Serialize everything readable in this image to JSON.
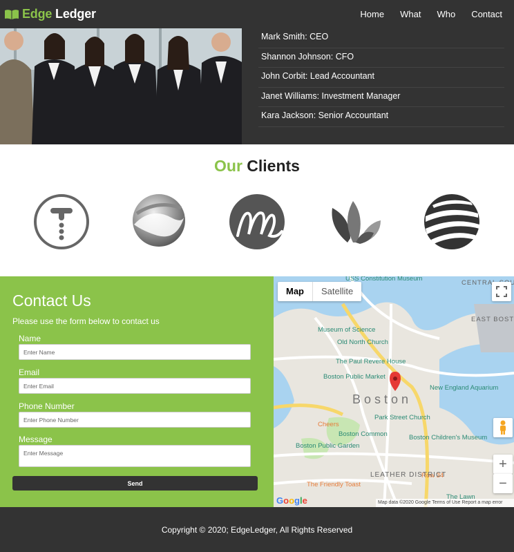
{
  "brand": {
    "accent": "Edge",
    "rest": "Ledger",
    "accent_color": "#8bc34a"
  },
  "nav": [
    {
      "label": "Home"
    },
    {
      "label": "What"
    },
    {
      "label": "Who"
    },
    {
      "label": "Contact"
    }
  ],
  "team": [
    {
      "text": "Mark Smith: CEO"
    },
    {
      "text": "Shannon Johnson: CFO"
    },
    {
      "text": "John Corbit: Lead Accountant"
    },
    {
      "text": "Janet Williams: Investment Manager"
    },
    {
      "text": "Kara Jackson: Senior Accountant"
    }
  ],
  "clients": {
    "title_accent": "Our",
    "title_rest": "Clients",
    "logos": [
      "t-circle-logo",
      "swirl-sphere-logo",
      "m-script-logo",
      "leaves-logo",
      "striped-globe-logo"
    ]
  },
  "contact": {
    "title": "Contact Us",
    "subtitle": "Please use the form below to contact us",
    "fields": [
      {
        "label": "Name",
        "placeholder": "Enter Name"
      },
      {
        "label": "Email",
        "placeholder": "Enter Email"
      },
      {
        "label": "Phone Number",
        "placeholder": "Enter Phone Number"
      },
      {
        "label": "Message",
        "placeholder": "Enter Message"
      }
    ],
    "send_label": "Send"
  },
  "map": {
    "type_map": "Map",
    "type_satellite": "Satellite",
    "city_label": "Boston",
    "places": [
      "USS Constitution Museum",
      "Museum of Science",
      "Old North Church",
      "The Paul Revere House",
      "Boston Public Market",
      "New England Aquarium",
      "Park Street Church",
      "Boston Common",
      "Boston Public Garden",
      "Boston Children's Museum",
      "Cheers",
      "The Friendly Toast",
      "Row 34",
      "The Lawn",
      "LEATHER DISTRICT",
      "CENTRAL SQUARE",
      "EAST BOSTON"
    ],
    "attribution": "Map data ©2020 Google  Terms of Use  Report a map error",
    "google": "Google"
  },
  "footer": {
    "text": "Copyright © 2020; EdgeLedger, All Rights Reserved"
  }
}
